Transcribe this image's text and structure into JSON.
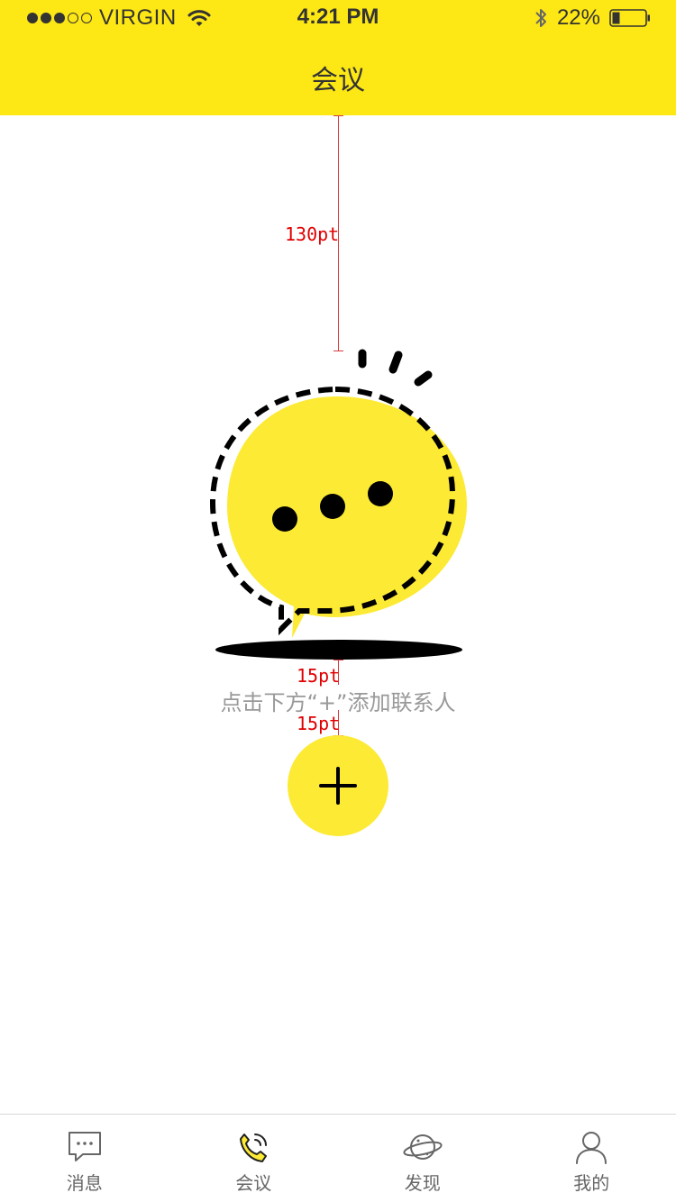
{
  "status_bar": {
    "carrier": "VIRGIN",
    "time": "4:21 PM",
    "battery": "22%",
    "signal_strength": 3,
    "signal_max": 5
  },
  "header": {
    "title": "会议",
    "background": "#FDE714"
  },
  "annotations": {
    "top_gap": "130pt",
    "gap_above_hint": "15pt",
    "gap_below_hint": "15pt"
  },
  "empty_state": {
    "hint": "点击下方“+”添加联系人",
    "add_button_icon": "plus-icon",
    "accent": "#FCEA35"
  },
  "tab_bar": {
    "tabs": [
      {
        "label": "消息",
        "icon": "message-icon",
        "active": false
      },
      {
        "label": "会议",
        "icon": "phone-call-icon",
        "active": true
      },
      {
        "label": "发现",
        "icon": "planet-icon",
        "active": false
      },
      {
        "label": "我的",
        "icon": "person-icon",
        "active": false
      }
    ]
  }
}
